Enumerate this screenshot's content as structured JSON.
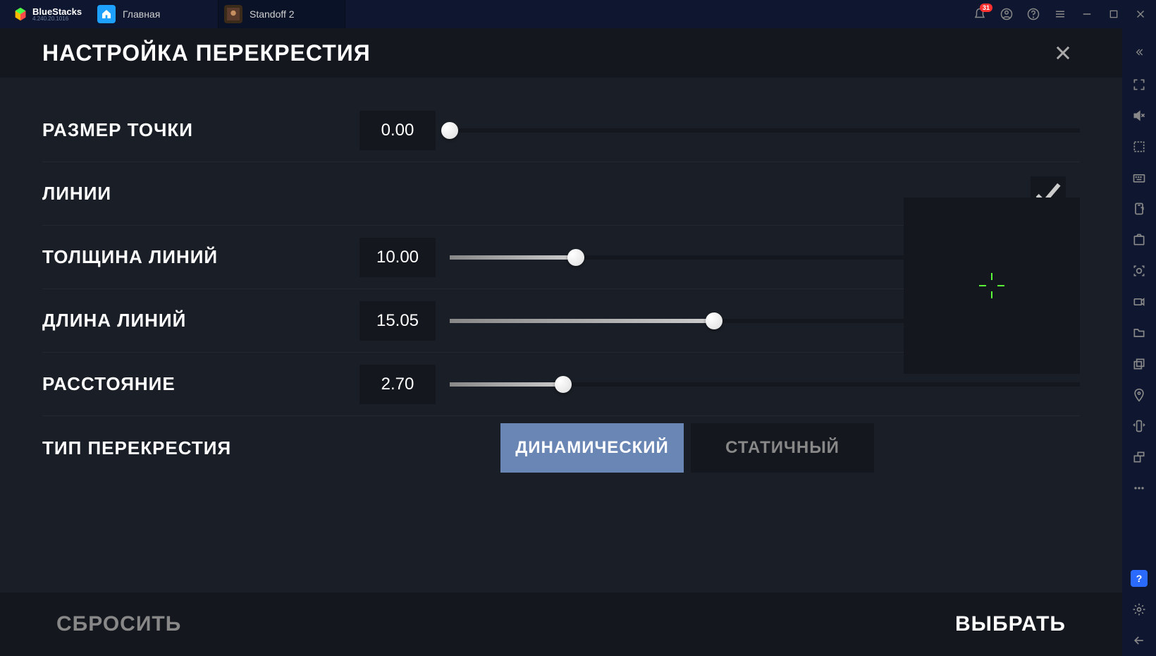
{
  "app": {
    "name": "BlueStacks",
    "version": "4.240.20.1016"
  },
  "tabs": [
    {
      "label": "Главная",
      "active": false
    },
    {
      "label": "Standoff 2",
      "active": true
    }
  ],
  "titlebar": {
    "notification_count": "31"
  },
  "header": {
    "title": "НАСТРОЙКА ПЕРЕКРЕСТИЯ"
  },
  "settings": {
    "dot_size": {
      "label": "РАЗМЕР ТОЧКИ",
      "value": "0.00",
      "percent": 0
    },
    "lines": {
      "label": "ЛИНИИ",
      "checked": true
    },
    "line_thickness": {
      "label": "ТОЛЩИНА ЛИНИЙ",
      "value": "10.00",
      "percent": 20
    },
    "line_length": {
      "label": "ДЛИНА ЛИНИЙ",
      "value": "15.05",
      "percent": 42
    },
    "distance": {
      "label": "РАССТОЯНИЕ",
      "value": "2.70",
      "percent": 18
    },
    "crosshair_type": {
      "label": "ТИП ПЕРЕКРЕСТИЯ",
      "options": [
        {
          "label": "ДИНАМИЧЕСКИЙ",
          "active": true
        },
        {
          "label": "СТАТИЧНЫЙ",
          "active": false
        }
      ]
    }
  },
  "footer": {
    "reset": "СБРОСИТЬ",
    "select": "ВЫБРАТЬ"
  }
}
